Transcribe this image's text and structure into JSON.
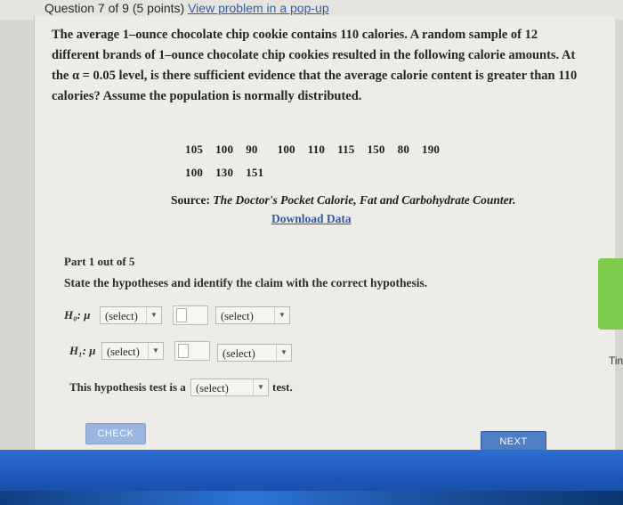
{
  "header": {
    "question": "Question 7 of 9 (5 points)",
    "popup_link": "View problem in a pop-up"
  },
  "problem": {
    "line1": "The average 1–ounce chocolate chip cookie contains 110 calories. A random sample of 12",
    "line2": "different brands of 1–ounce chocolate chip cookies resulted in the following calorie amounts. At",
    "line3": "the α = 0.05 level, is there sufficient evidence that the average calorie content is greater than 110",
    "line4": "calories? Assume the population is normally distributed."
  },
  "data_row1": [
    "105",
    "100",
    "90",
    "100",
    "110",
    "115",
    "150",
    "80",
    "190"
  ],
  "data_row2": [
    "100",
    "130",
    "151"
  ],
  "source": {
    "label": "Source:",
    "title": "The Doctor's Pocket Calorie, Fat and Carbohydrate Counter."
  },
  "download_link": "Download Data",
  "part": "Part 1 out of 5",
  "instructions": "State the hypotheses and identify the claim with the correct hypothesis.",
  "h0": {
    "label": "H₀: μ",
    "select1": "(select)",
    "select2": "(select)"
  },
  "h1": {
    "label": "H₁: μ",
    "select1": "(select)",
    "select2": "(select)"
  },
  "test_line": {
    "prefix": "This hypothesis test is a",
    "select": "(select)",
    "suffix": "test."
  },
  "buttons": {
    "check": "CHECK",
    "next": "NEXT"
  },
  "side_label": "Tin",
  "icons": {
    "dropdown": "triangle-down-icon"
  },
  "colors": {
    "link": "#2f5da8",
    "next_button": "#4e7fc4",
    "check_button": "#9ab6e0",
    "side_tab": "#7fcc4c"
  }
}
